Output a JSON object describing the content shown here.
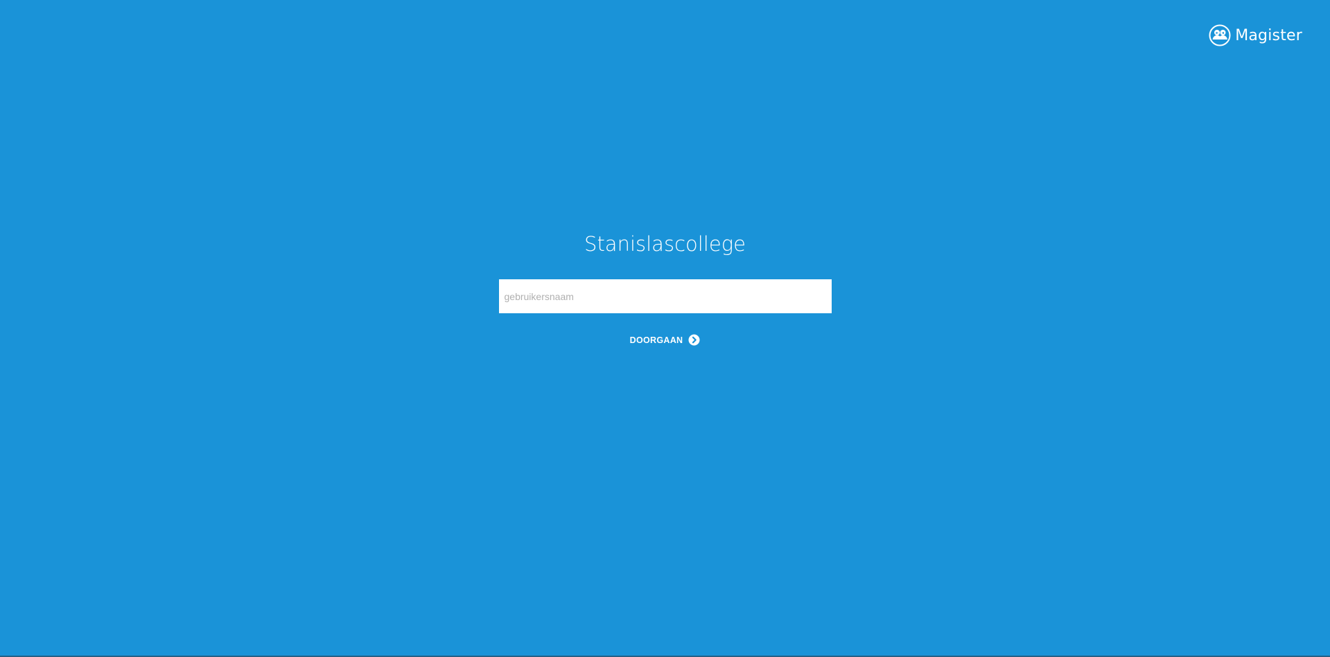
{
  "brand": {
    "name": "Magister",
    "icon": "magister-people-icon"
  },
  "login": {
    "school_name": "Stanislascollege",
    "username_placeholder": "gebruikersnaam",
    "username_value": "",
    "continue_label": "DOORGAAN",
    "continue_icon": "chevron-circle-right-icon"
  },
  "colors": {
    "background": "#1a93d8",
    "text": "#ffffff",
    "input_background": "#ffffff",
    "placeholder": "#b0b0b0"
  }
}
